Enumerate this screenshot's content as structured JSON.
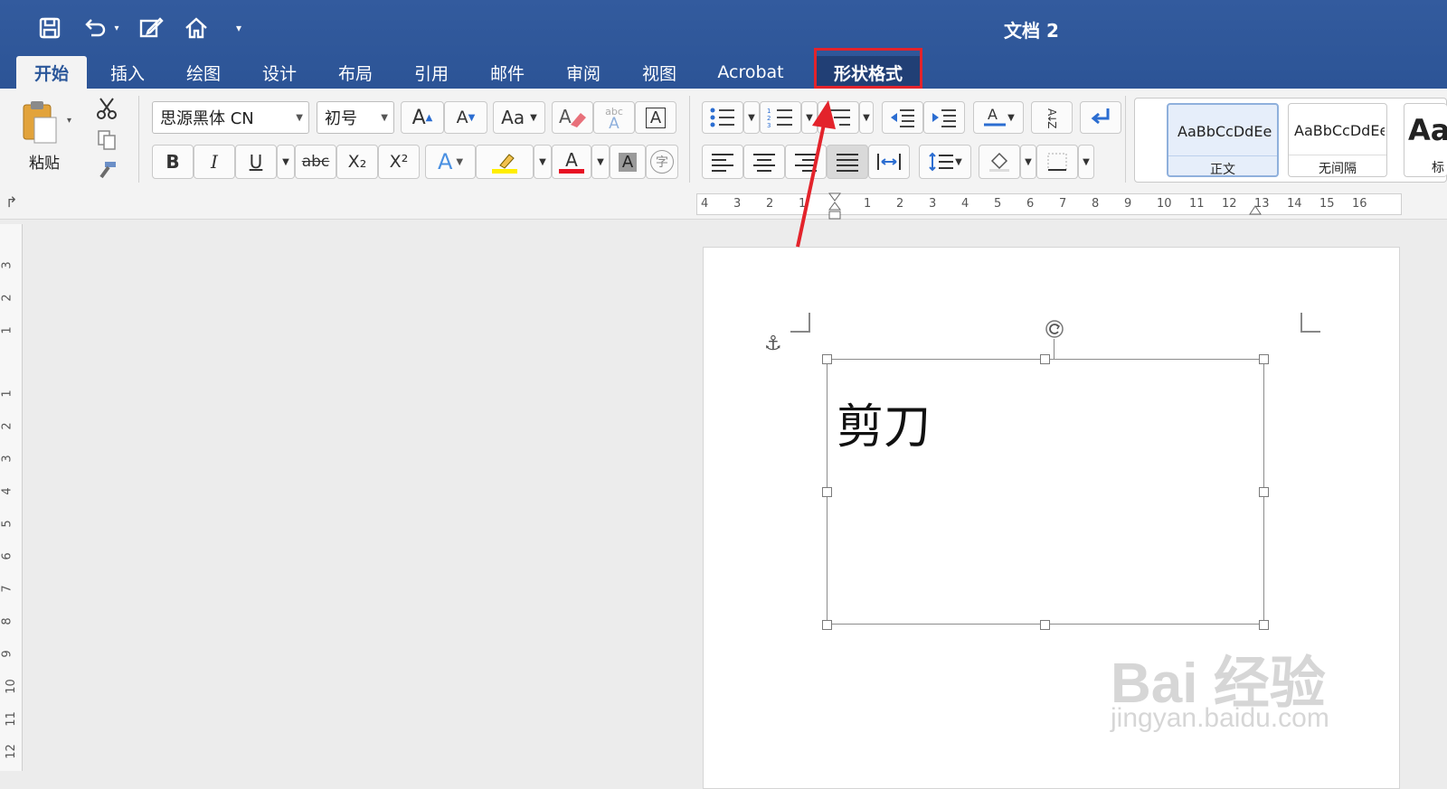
{
  "window": {
    "title": "文档 2"
  },
  "tabs": [
    {
      "label": "开始"
    },
    {
      "label": "插入"
    },
    {
      "label": "绘图"
    },
    {
      "label": "设计"
    },
    {
      "label": "布局"
    },
    {
      "label": "引用"
    },
    {
      "label": "邮件"
    },
    {
      "label": "审阅"
    },
    {
      "label": "视图"
    },
    {
      "label": "Acrobat"
    },
    {
      "label": "形状格式"
    }
  ],
  "ribbon": {
    "paste_label": "粘贴",
    "font_name": "思源黑体 CN",
    "font_size": "初号",
    "grow_font": "A",
    "shrink_font": "A",
    "change_case": "Aa",
    "bold": "B",
    "italic": "I",
    "underline": "U",
    "strikethrough": "abc",
    "subscript": "X₂",
    "superscript": "X²",
    "text_effects": "A",
    "font_color": "A",
    "char_shading": "A",
    "phonetic": "字",
    "clear_format_abc": "abc",
    "char_border": "A",
    "sort": "A↓Z",
    "styles": [
      {
        "preview": "AaBbCcDdEe",
        "name": "正文"
      },
      {
        "preview": "AaBbCcDdEe",
        "name": "无间隔"
      },
      {
        "preview": "Aa",
        "name": "标"
      }
    ]
  },
  "ruler": {
    "h_ticks": [
      "4",
      "3",
      "2",
      "1",
      "1",
      "2",
      "3",
      "4",
      "5",
      "6",
      "7",
      "8",
      "9",
      "10",
      "11",
      "12",
      "13",
      "14",
      "15",
      "16"
    ],
    "v_ticks": [
      "3",
      "2",
      "1",
      "1",
      "2",
      "3",
      "4",
      "5",
      "6",
      "7",
      "8",
      "9",
      "10",
      "11",
      "12"
    ]
  },
  "document": {
    "textbox_text": "剪刀"
  },
  "watermark": {
    "brand": "Bai 经验",
    "url": "jingyan.baidu.com"
  },
  "colors": {
    "accent": "#2b579a",
    "highlight_box": "#e3232b",
    "font_color_bar": "#e81123",
    "highlight_bar": "#ffee00"
  }
}
